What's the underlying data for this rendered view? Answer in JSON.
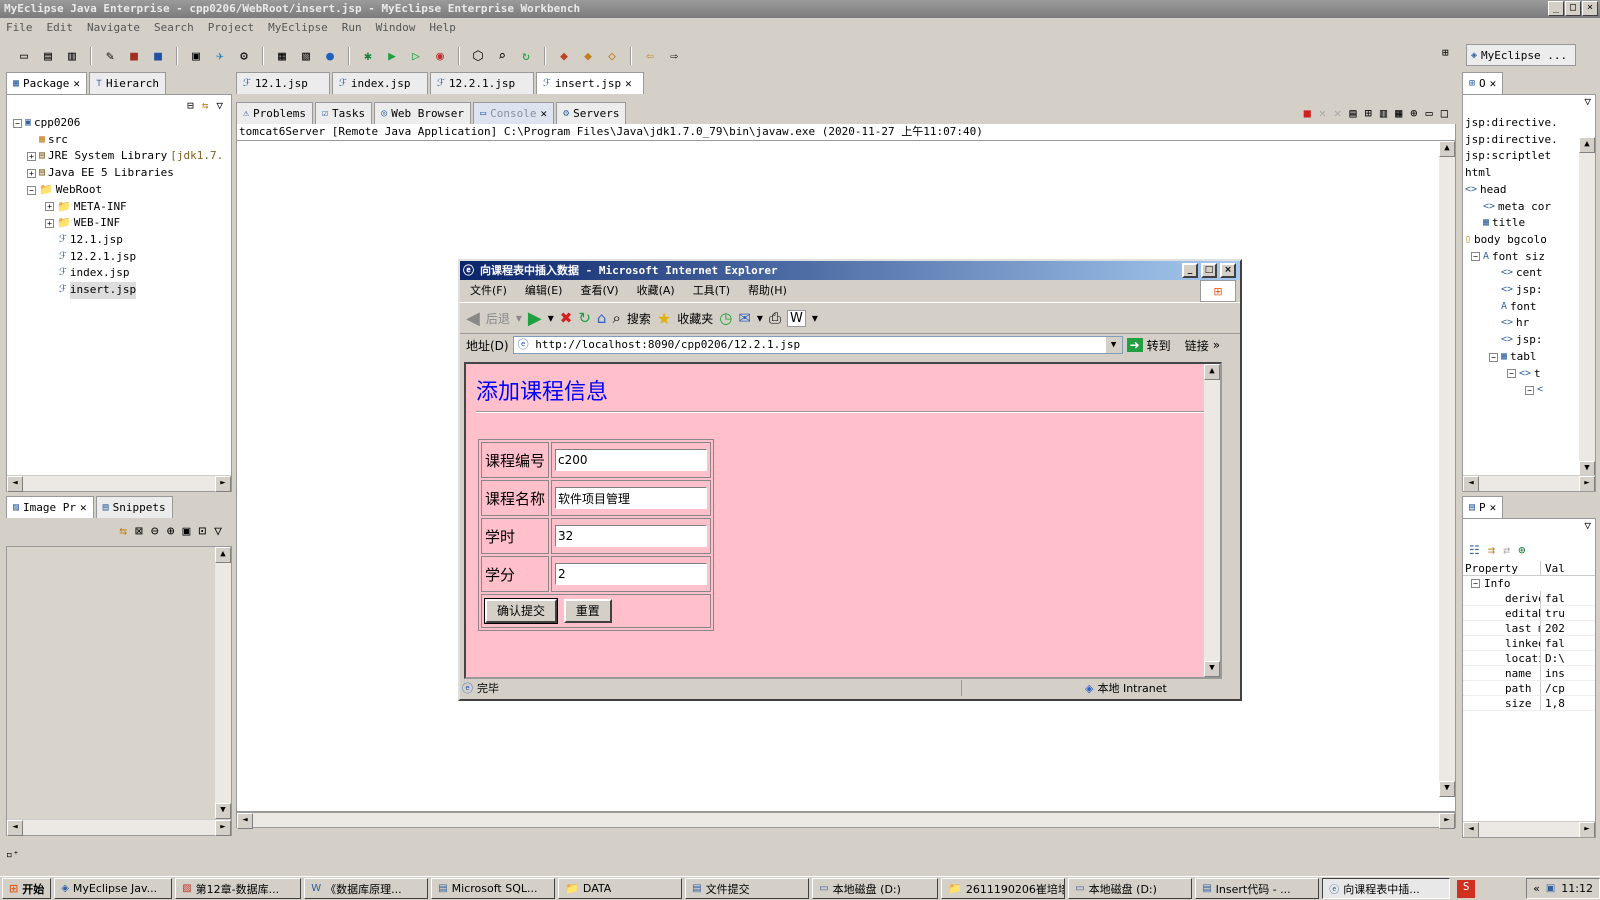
{
  "window": {
    "title": "MyEclipse Java Enterprise - cpp0206/WebRoot/insert.jsp - MyEclipse Enterprise Workbench"
  },
  "menu": [
    "File",
    "Edit",
    "Navigate",
    "Search",
    "Project",
    "MyEclipse",
    "Run",
    "Window",
    "Help"
  ],
  "perspective": {
    "label": "MyEclipse ..."
  },
  "left_top": {
    "tabs": [
      "Package",
      "Hierarch"
    ],
    "tree": {
      "project": "cpp0206",
      "src": "src",
      "jre": "JRE System Library",
      "jre_ver": "[jdk1.7.",
      "javaee": "Java EE 5 Libraries",
      "webroot": "WebRoot",
      "metainf": "META-INF",
      "webinf": "WEB-INF",
      "f1": "12.1.jsp",
      "f2": "12.2.1.jsp",
      "f3": "index.jsp",
      "f4": "insert.jsp"
    }
  },
  "left_bottom": {
    "tabs": [
      "Image Pr",
      "Snippets"
    ]
  },
  "editor_tabs": [
    "12.1.jsp",
    "index.jsp",
    "12.2.1.jsp",
    "insert.jsp"
  ],
  "console": {
    "tabs": [
      "Problems",
      "Tasks",
      "Web Browser",
      "Console",
      "Servers"
    ],
    "header": "tomcat6Server [Remote Java Application] C:\\Program Files\\Java\\jdk1.7.0_79\\bin\\javaw.exe (2020-11-27 上午11:07:40)"
  },
  "outline": {
    "tab": "O",
    "items": [
      "jsp:directive.",
      "jsp:directive.",
      "jsp:scriptlet",
      "html",
      "head",
      "meta cor",
      "title",
      "body bgcolo",
      "font siz",
      "cent",
      "jsp:",
      "font",
      "hr",
      "jsp:",
      "tabl",
      "t",
      "<"
    ]
  },
  "properties": {
    "tab": "P",
    "col_property": "Property",
    "col_value": "Val",
    "group": "Info",
    "rows": [
      {
        "k": "derive",
        "v": "fal"
      },
      {
        "k": "editab",
        "v": "tru"
      },
      {
        "k": "last m",
        "v": "202"
      },
      {
        "k": "linked",
        "v": "fal"
      },
      {
        "k": "locati",
        "v": "D:\\"
      },
      {
        "k": "name",
        "v": "ins"
      },
      {
        "k": "path",
        "v": "/cp"
      },
      {
        "k": "size",
        "v": "1,8"
      }
    ]
  },
  "ie": {
    "title": "向课程表中插入数据 - Microsoft Internet Explorer",
    "menu": [
      "文件(F)",
      "编辑(E)",
      "查看(V)",
      "收藏(A)",
      "工具(T)",
      "帮助(H)"
    ],
    "back": "后退",
    "search": "搜索",
    "favorites": "收藏夹",
    "address_label": "地址(D)",
    "url": "http://localhost:8090/cpp0206/12.2.1.jsp",
    "go": "转到",
    "links": "链接",
    "status": "完毕",
    "zone": "本地 Intranet"
  },
  "form": {
    "heading": "添加课程信息",
    "labels": [
      "课程编号",
      "课程名称",
      "学时",
      "学分"
    ],
    "values": [
      "c200",
      "软件项目管理",
      "32",
      "2"
    ],
    "submit": "确认提交",
    "reset": "重置"
  },
  "taskbar": {
    "start": "开始",
    "items": [
      "MyEclipse Jav...",
      "第12章-数据库...",
      "《数据库原理...",
      "Microsoft SQL...",
      "DATA",
      "文件提交",
      "本地磁盘 (D:)",
      "2611190206崔培培",
      "本地磁盘 (D:)",
      "Insert代码 - ...",
      "向课程表中插..."
    ],
    "clock": "11:12"
  }
}
